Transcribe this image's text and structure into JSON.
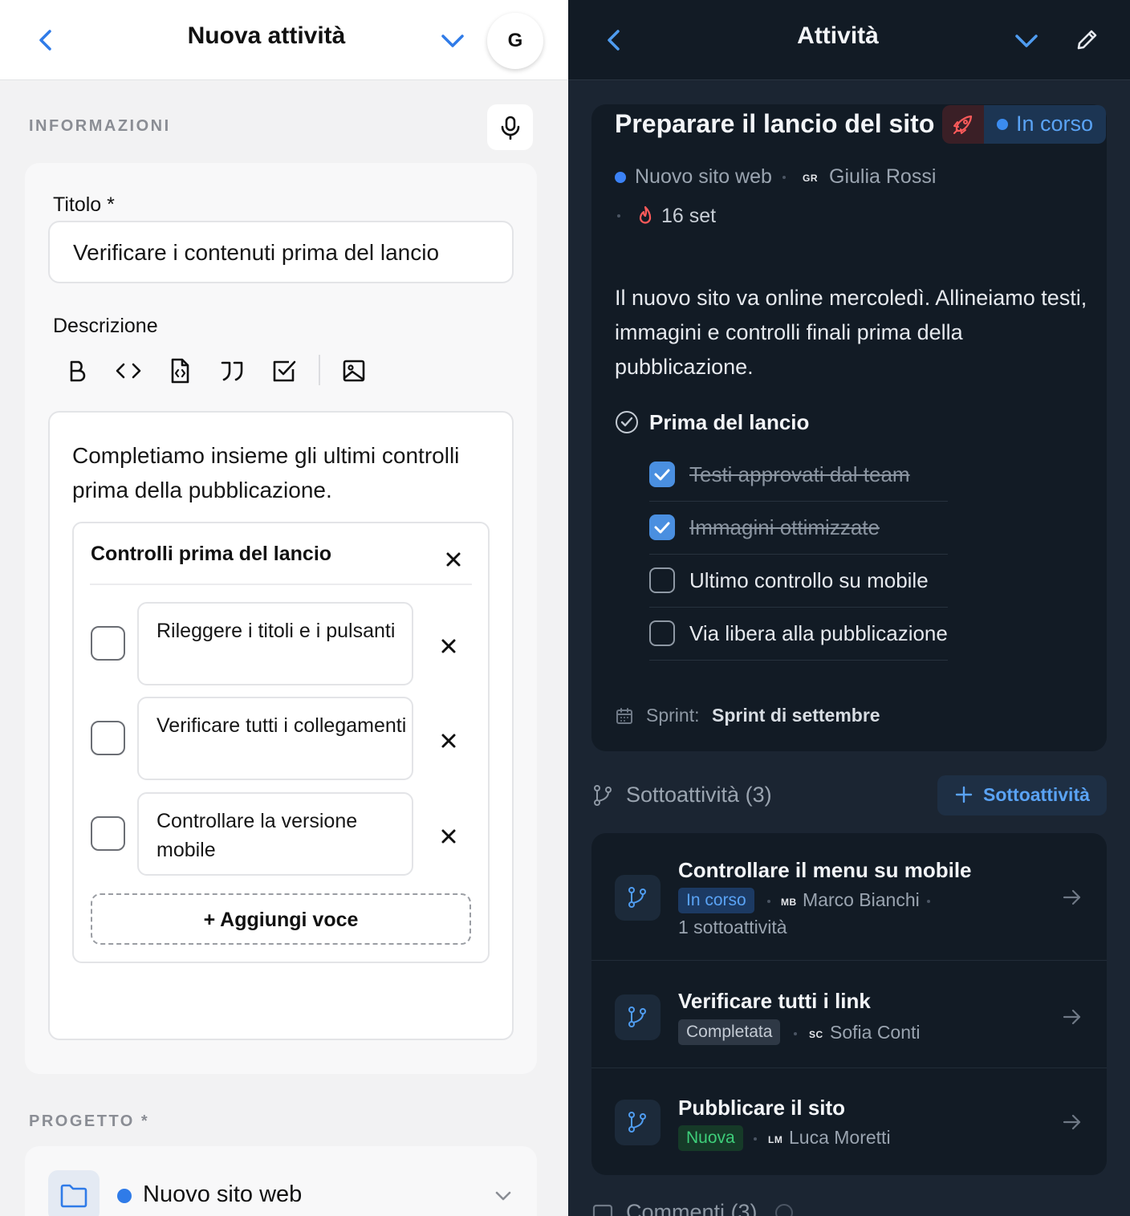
{
  "left_panel": {
    "header": {
      "title": "Nuova attività",
      "avatar_initial": "G"
    },
    "informazioni_label": "INFORMAZIONI",
    "title_field": {
      "label": "Titolo *",
      "value": "Verificare i contenuti prima del lancio"
    },
    "description": {
      "label": "Descrizione",
      "toolbar": [
        "bold-icon",
        "code-icon",
        "code-block-icon",
        "quote-icon",
        "checklist-icon",
        "image-icon"
      ],
      "text": "Completiamo insieme gli ultimi controlli prima della pubblicazione.",
      "checklist": {
        "title": "Controlli prima del lancio",
        "items": [
          {
            "text": "Rileggere i titoli e i pulsanti",
            "checked": false
          },
          {
            "text": "Verificare tutti i collegamenti",
            "checked": false
          },
          {
            "text": "Controllare la versione mobile",
            "checked": false
          }
        ],
        "add_label": "+ Aggiungi voce"
      }
    },
    "project": {
      "label": "PROGETTO *",
      "value": "Nuovo sito web",
      "dot_color": "#2f7be8"
    }
  },
  "right_panel": {
    "header": {
      "title": "Attività"
    },
    "task": {
      "title": "Preparare il lancio del sito",
      "status": "In corso",
      "project": "Nuovo sito web",
      "assignee_initials": "GR",
      "assignee": "Giulia Rossi",
      "due": "16 set",
      "description": "Il nuovo sito va online mercoledì. Allineiamo testi, immagini e controlli finali prima della pubblicazione.",
      "checklist": {
        "title": "Prima del lancio",
        "items": [
          {
            "text": "Testi approvati dal team",
            "checked": true
          },
          {
            "text": "Immagini ottimizzate",
            "checked": true
          },
          {
            "text": "Ultimo controllo su mobile",
            "checked": false
          },
          {
            "text": "Via libera alla pubblicazione",
            "checked": false
          }
        ]
      },
      "sprint_label": "Sprint:",
      "sprint_value": "Sprint di settembre"
    },
    "subtasks": {
      "heading": "Sottoattività (3)",
      "add_label": "Sottoattività",
      "items": [
        {
          "title": "Controllare il menu su mobile",
          "status": "In corso",
          "initials": "MB",
          "assignee": "Marco Bianchi",
          "extra": "1 sottoattività"
        },
        {
          "title": "Verificare tutti i link",
          "status": "Completata",
          "initials": "SC",
          "assignee": "Sofia Conti"
        },
        {
          "title": "Pubblicare il sito",
          "status": "Nuova",
          "initials": "LM",
          "assignee": "Luca Moretti"
        }
      ]
    },
    "comments_heading": "Commenti (3)"
  },
  "colors": {
    "accent": "#2f7be8",
    "dark_bg": "#1b2532",
    "card_dark": "#121b25",
    "status_blue": "#5aa3f5",
    "status_green": "#3ecf7a",
    "danger": "#ff5a5a"
  }
}
